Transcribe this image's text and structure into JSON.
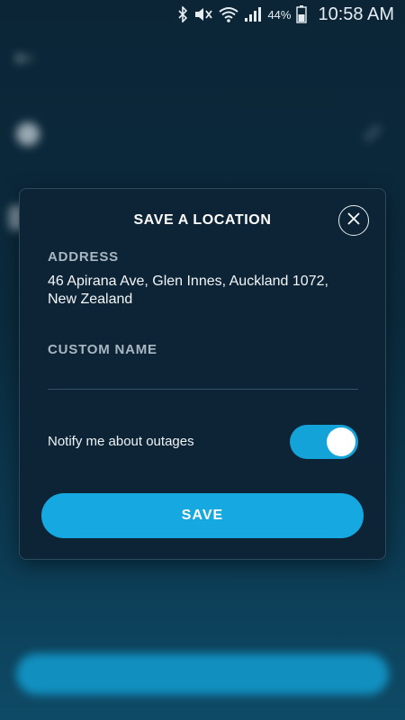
{
  "status_bar": {
    "battery": "44%",
    "time": "10:58 AM",
    "icons": [
      "bluetooth-icon",
      "mute-icon",
      "wifi-icon",
      "signal-icon",
      "battery-icon"
    ]
  },
  "background": {
    "icons": [
      "back-arrow-icon",
      "location-icon",
      "edit-icon"
    ]
  },
  "modal": {
    "title": "SAVE A LOCATION",
    "close_icon": "close-icon",
    "address_label": "ADDRESS",
    "address_value": "46 Apirana Ave, Glen Innes, Auckland 1072, New Zealand",
    "custom_name_label": "CUSTOM NAME",
    "custom_name_value": "",
    "notify_label": "Notify me about outages",
    "notify_enabled": true,
    "save_label": "SAVE"
  },
  "colors": {
    "accent": "#15a8e1",
    "modal_bg": "#0d2436",
    "label": "#a8b7c2"
  }
}
